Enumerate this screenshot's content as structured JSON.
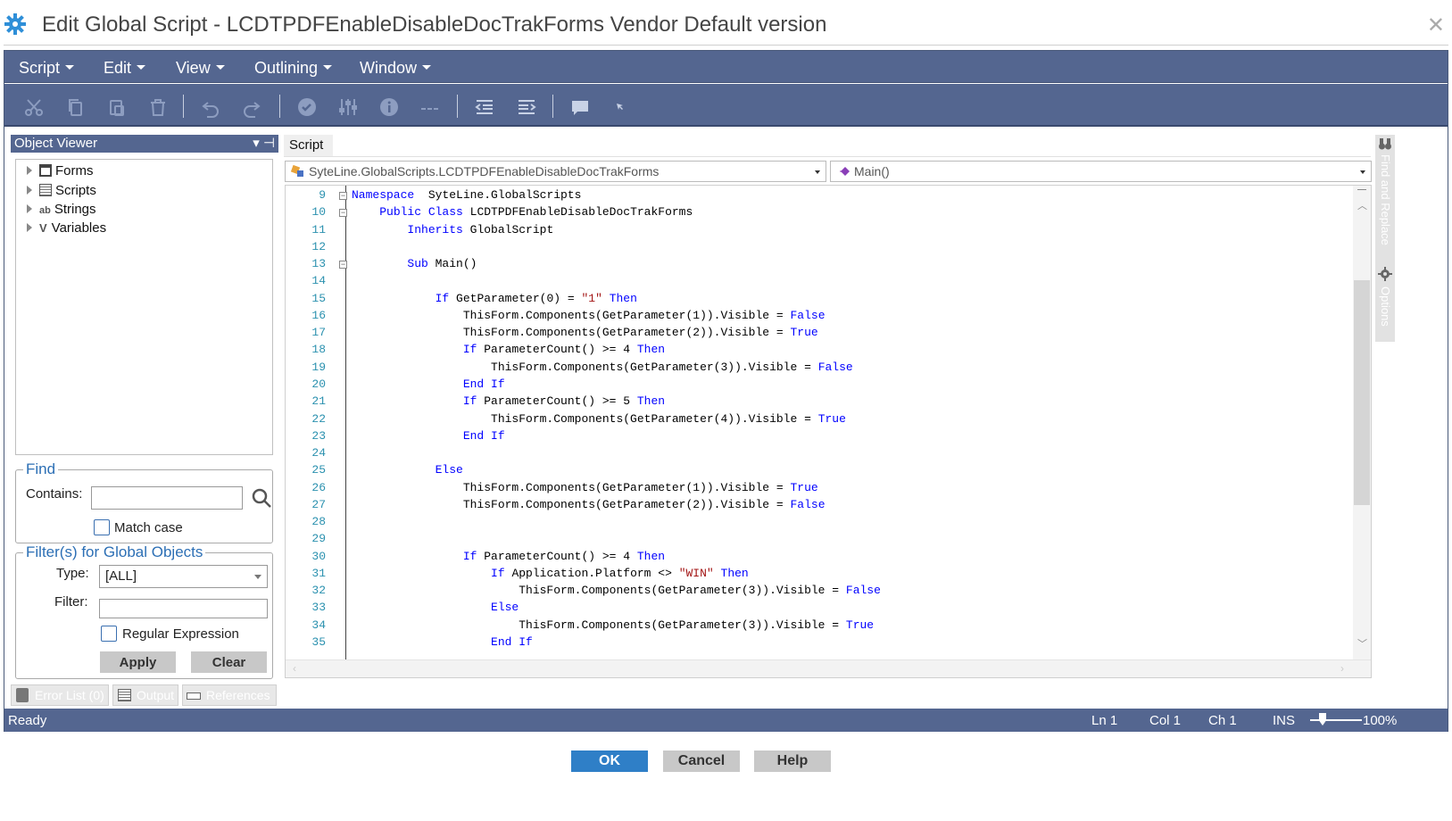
{
  "window": {
    "title": "Edit Global Script - LCDTPDFEnableDisableDocTrakForms Vendor Default version",
    "close_glyph": "✕"
  },
  "menu": [
    "Script",
    "Edit",
    "View",
    "Outlining",
    "Window"
  ],
  "toolbar": {
    "buttons": [
      "scissors-icon",
      "copy-icon",
      "paste-icon",
      "delete-icon",
      "undo-icon",
      "redo-icon",
      "check-icon",
      "settings-sliders-icon",
      "info-icon",
      "ellipsis-icon",
      "outdent-icon",
      "indent-icon",
      "comment-icon",
      "cursor-icon"
    ]
  },
  "object_viewer": {
    "title": "Object Viewer",
    "pin_glyph": "▾ ⊣",
    "tree": [
      {
        "label": "Forms",
        "icon": "form-icon"
      },
      {
        "label": "Scripts",
        "icon": "script-icon"
      },
      {
        "label": "Strings",
        "icon": "strings-icon",
        "icon_text": "ab"
      },
      {
        "label": "Variables",
        "icon": "variables-icon",
        "icon_text": "V"
      }
    ]
  },
  "find": {
    "legend": "Find",
    "contains_label": "Contains:",
    "contains_value": "",
    "match_case_label": "Match case"
  },
  "filters": {
    "legend": "Filter(s) for Global Objects",
    "type_label": "Type:",
    "type_value": "[ALL]",
    "filter_label": "Filter:",
    "filter_value": "",
    "regex_label": "Regular Expression",
    "apply_label": "Apply",
    "clear_label": "Clear"
  },
  "bottom_tabs": [
    "Error List (0)",
    "Output",
    "References"
  ],
  "script": {
    "tab_label": "Script",
    "class_dropdown": "SyteLine.GlobalScripts.LCDTPDFEnableDisableDocTrakForms",
    "method_dropdown": "Main()",
    "lines": [
      {
        "n": "9",
        "fold": "⊟",
        "segs": [
          [
            "kw",
            "Namespace"
          ],
          [
            "",
            "  SyteLine.GlobalScripts"
          ]
        ]
      },
      {
        "n": "10",
        "fold": "⊟",
        "segs": [
          [
            "",
            "    "
          ],
          [
            "kw",
            "Public Class"
          ],
          [
            "",
            " LCDTPDFEnableDisableDocTrakForms"
          ]
        ]
      },
      {
        "n": "11",
        "fold": "",
        "segs": [
          [
            "",
            "        "
          ],
          [
            "kw",
            "Inherits"
          ],
          [
            "",
            " GlobalScript"
          ]
        ]
      },
      {
        "n": "12",
        "fold": "",
        "segs": [
          [
            "",
            ""
          ]
        ]
      },
      {
        "n": "13",
        "fold": "⊟",
        "segs": [
          [
            "",
            "        "
          ],
          [
            "kw",
            "Sub"
          ],
          [
            "",
            " Main()"
          ]
        ]
      },
      {
        "n": "14",
        "fold": "",
        "segs": [
          [
            "",
            ""
          ]
        ]
      },
      {
        "n": "15",
        "fold": "",
        "segs": [
          [
            "",
            "            "
          ],
          [
            "kw",
            "If"
          ],
          [
            "",
            " GetParameter(0) = "
          ],
          [
            "str",
            "\"1\""
          ],
          [
            "",
            " "
          ],
          [
            "kw",
            "Then"
          ]
        ]
      },
      {
        "n": "16",
        "fold": "",
        "segs": [
          [
            "",
            "                ThisForm.Components(GetParameter(1)).Visible = "
          ],
          [
            "kw",
            "False"
          ]
        ]
      },
      {
        "n": "17",
        "fold": "",
        "segs": [
          [
            "",
            "                ThisForm.Components(GetParameter(2)).Visible = "
          ],
          [
            "kw",
            "True"
          ]
        ]
      },
      {
        "n": "18",
        "fold": "",
        "segs": [
          [
            "",
            "                "
          ],
          [
            "kw",
            "If"
          ],
          [
            "",
            " ParameterCount() >= 4 "
          ],
          [
            "kw",
            "Then"
          ]
        ]
      },
      {
        "n": "19",
        "fold": "",
        "segs": [
          [
            "",
            "                    ThisForm.Components(GetParameter(3)).Visible = "
          ],
          [
            "kw",
            "False"
          ]
        ]
      },
      {
        "n": "20",
        "fold": "",
        "segs": [
          [
            "",
            "                "
          ],
          [
            "kw",
            "End If"
          ]
        ]
      },
      {
        "n": "21",
        "fold": "",
        "segs": [
          [
            "",
            "                "
          ],
          [
            "kw",
            "If"
          ],
          [
            "",
            " ParameterCount() >= 5 "
          ],
          [
            "kw",
            "Then"
          ]
        ]
      },
      {
        "n": "22",
        "fold": "",
        "segs": [
          [
            "",
            "                    ThisForm.Components(GetParameter(4)).Visible = "
          ],
          [
            "kw",
            "True"
          ]
        ]
      },
      {
        "n": "23",
        "fold": "",
        "segs": [
          [
            "",
            "                "
          ],
          [
            "kw",
            "End If"
          ]
        ]
      },
      {
        "n": "24",
        "fold": "",
        "segs": [
          [
            "",
            ""
          ]
        ]
      },
      {
        "n": "25",
        "fold": "",
        "segs": [
          [
            "",
            "            "
          ],
          [
            "kw",
            "Else"
          ]
        ]
      },
      {
        "n": "26",
        "fold": "",
        "segs": [
          [
            "",
            "                ThisForm.Components(GetParameter(1)).Visible = "
          ],
          [
            "kw",
            "True"
          ]
        ]
      },
      {
        "n": "27",
        "fold": "",
        "segs": [
          [
            "",
            "                ThisForm.Components(GetParameter(2)).Visible = "
          ],
          [
            "kw",
            "False"
          ]
        ]
      },
      {
        "n": "28",
        "fold": "",
        "segs": [
          [
            "",
            ""
          ]
        ]
      },
      {
        "n": "29",
        "fold": "",
        "segs": [
          [
            "",
            ""
          ]
        ]
      },
      {
        "n": "30",
        "fold": "",
        "segs": [
          [
            "",
            "                "
          ],
          [
            "kw",
            "If"
          ],
          [
            "",
            " ParameterCount() >= 4 "
          ],
          [
            "kw",
            "Then"
          ]
        ]
      },
      {
        "n": "31",
        "fold": "",
        "segs": [
          [
            "",
            "                    "
          ],
          [
            "kw",
            "If"
          ],
          [
            "",
            " Application.Platform <> "
          ],
          [
            "str",
            "\"WIN\""
          ],
          [
            "",
            " "
          ],
          [
            "kw",
            "Then"
          ]
        ]
      },
      {
        "n": "32",
        "fold": "",
        "segs": [
          [
            "",
            "                        ThisForm.Components(GetParameter(3)).Visible = "
          ],
          [
            "kw",
            "False"
          ]
        ]
      },
      {
        "n": "33",
        "fold": "",
        "segs": [
          [
            "",
            "                    "
          ],
          [
            "kw",
            "Else"
          ]
        ]
      },
      {
        "n": "34",
        "fold": "",
        "segs": [
          [
            "",
            "                        ThisForm.Components(GetParameter(3)).Visible = "
          ],
          [
            "kw",
            "True"
          ]
        ]
      },
      {
        "n": "35",
        "fold": "",
        "segs": [
          [
            "",
            "                    "
          ],
          [
            "kw",
            "End If"
          ]
        ]
      }
    ]
  },
  "side_panel": [
    "Find and Replace",
    "Options"
  ],
  "status": {
    "state": "Ready",
    "ln": "Ln 1",
    "col": "Col 1",
    "ch": "Ch 1",
    "mode": "INS",
    "zoom": "100%"
  },
  "dialog": {
    "ok": "OK",
    "cancel": "Cancel",
    "help": "Help"
  },
  "colors": {
    "accent": "#546690",
    "keyword": "#0000ff",
    "string": "#a31515",
    "line_number": "#2b91af",
    "ok_button": "#2f7fc7"
  }
}
